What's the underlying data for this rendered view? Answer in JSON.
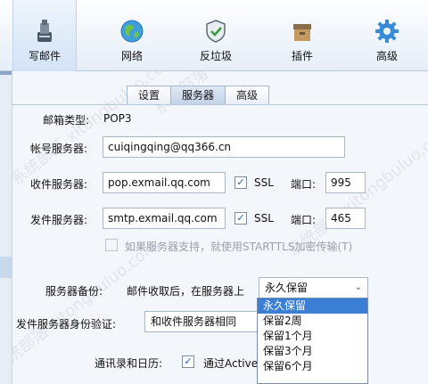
{
  "toolbar": {
    "items": [
      {
        "label": "写邮件",
        "icon": "write-mail-icon"
      },
      {
        "label": "网络",
        "icon": "globe-icon"
      },
      {
        "label": "反垃圾",
        "icon": "shield-icon"
      },
      {
        "label": "插件",
        "icon": "box-icon"
      },
      {
        "label": "高级",
        "icon": "gear-icon"
      }
    ]
  },
  "tabs": [
    "设置",
    "服务器",
    "高级"
  ],
  "active_tab": "服务器",
  "form": {
    "mailbox_type_label": "邮箱类型:",
    "mailbox_type_value": "POP3",
    "account_label": "帐号服务器:",
    "account_value": "cuiqingqing@qq366.cn",
    "incoming_label": "收件服务器:",
    "incoming_value": "pop.exmail.qq.com",
    "incoming_ssl_label": "SSL",
    "incoming_ssl_checked": true,
    "incoming_port_label": "端口:",
    "incoming_port_value": "995",
    "outgoing_label": "发件服务器:",
    "outgoing_value": "smtp.exmail.qq.com",
    "outgoing_ssl_label": "SSL",
    "outgoing_ssl_checked": true,
    "outgoing_port_label": "端口:",
    "outgoing_port_value": "465",
    "starttls_label": "如果服务器支持，就使用STARTTLS加密传输(T)",
    "starttls_checked": false,
    "backup_label": "服务器备份:",
    "backup_desc": "邮件收取后，在服务器上",
    "backup_selected": "永久保留",
    "backup_options": [
      "永久保留",
      "保留2周",
      "保留1个月",
      "保留3个月",
      "保留6个月"
    ],
    "auth_label": "发件服务器身份验证:",
    "auth_selected": "和收件服务器相同",
    "contacts_label": "通讯录和日历:",
    "contacts_checkbox_label": "通过Active",
    "contacts_checked": true
  },
  "watermark_text": "系统部落 xitongbuluo.com",
  "colors": {
    "accent": "#3b7fd4",
    "toolbar_bg": "#e6eef8",
    "check": "#1b5fb5"
  }
}
